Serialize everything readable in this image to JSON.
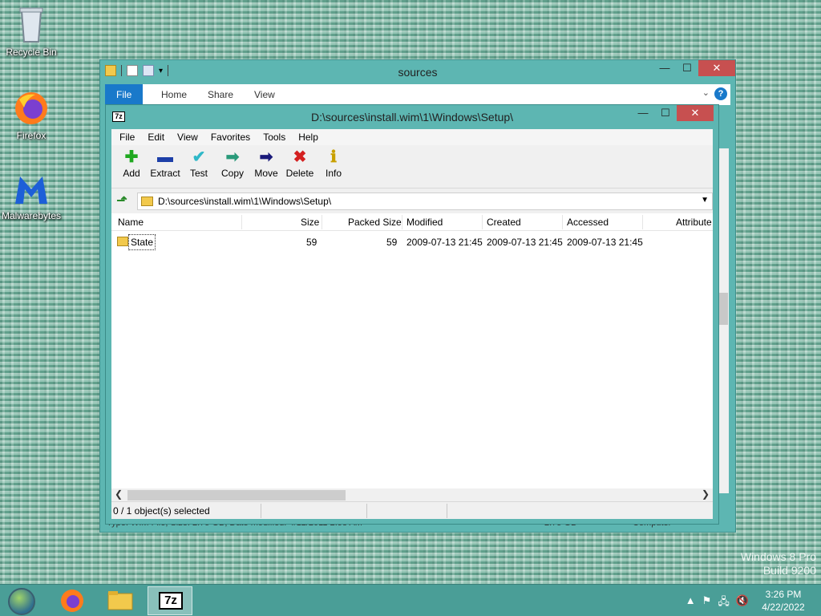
{
  "desktop": {
    "icons": [
      {
        "label": "Recycle Bin"
      },
      {
        "label": "Firefox"
      },
      {
        "label": "Malwarebytes"
      }
    ],
    "watermark": {
      "line1": "Windows 8 Pro",
      "line2": "Build 9200"
    }
  },
  "explorer": {
    "title": "sources",
    "tabs": [
      "File",
      "Home",
      "Share",
      "View"
    ],
    "status_left": "Type: WIM File, Size: 2.75 GB, Date modified: 4/12/2011 2:58 AM",
    "status_size": "2.75 GB",
    "status_location": "Computer"
  },
  "sevenzip": {
    "app_icon": "7z",
    "title": "D:\\sources\\install.wim\\1\\Windows\\Setup\\",
    "menu": [
      "File",
      "Edit",
      "View",
      "Favorites",
      "Tools",
      "Help"
    ],
    "toolbar": [
      {
        "label": "Add",
        "icon": "add-icon",
        "glyph": "✚",
        "color": "#1fa81f"
      },
      {
        "label": "Extract",
        "icon": "extract-icon",
        "glyph": "▬",
        "color": "#1d3fa8"
      },
      {
        "label": "Test",
        "icon": "test-icon",
        "glyph": "✔",
        "color": "#2fb8c8"
      },
      {
        "label": "Copy",
        "icon": "copy-icon",
        "glyph": "➡",
        "color": "#2a9a7a"
      },
      {
        "label": "Move",
        "icon": "move-icon",
        "glyph": "➡",
        "color": "#1a1a7a"
      },
      {
        "label": "Delete",
        "icon": "delete-icon",
        "glyph": "✖",
        "color": "#d42020"
      },
      {
        "label": "Info",
        "icon": "info-icon",
        "glyph": "ℹ",
        "color": "#c8a000"
      }
    ],
    "address": "D:\\sources\\install.wim\\1\\Windows\\Setup\\",
    "columns": [
      "Name",
      "Size",
      "Packed Size",
      "Modified",
      "Created",
      "Accessed",
      "Attribute"
    ],
    "rows": [
      {
        "name": "State",
        "size": "59",
        "packed": "59",
        "modified": "2009-07-13 21:45",
        "created": "2009-07-13 21:45",
        "accessed": "2009-07-13 21:45"
      }
    ],
    "status": "0 / 1 object(s) selected"
  },
  "taskbar": {
    "time": "3:26 PM",
    "date": "4/22/2022",
    "pinned_app_label": "7z"
  }
}
